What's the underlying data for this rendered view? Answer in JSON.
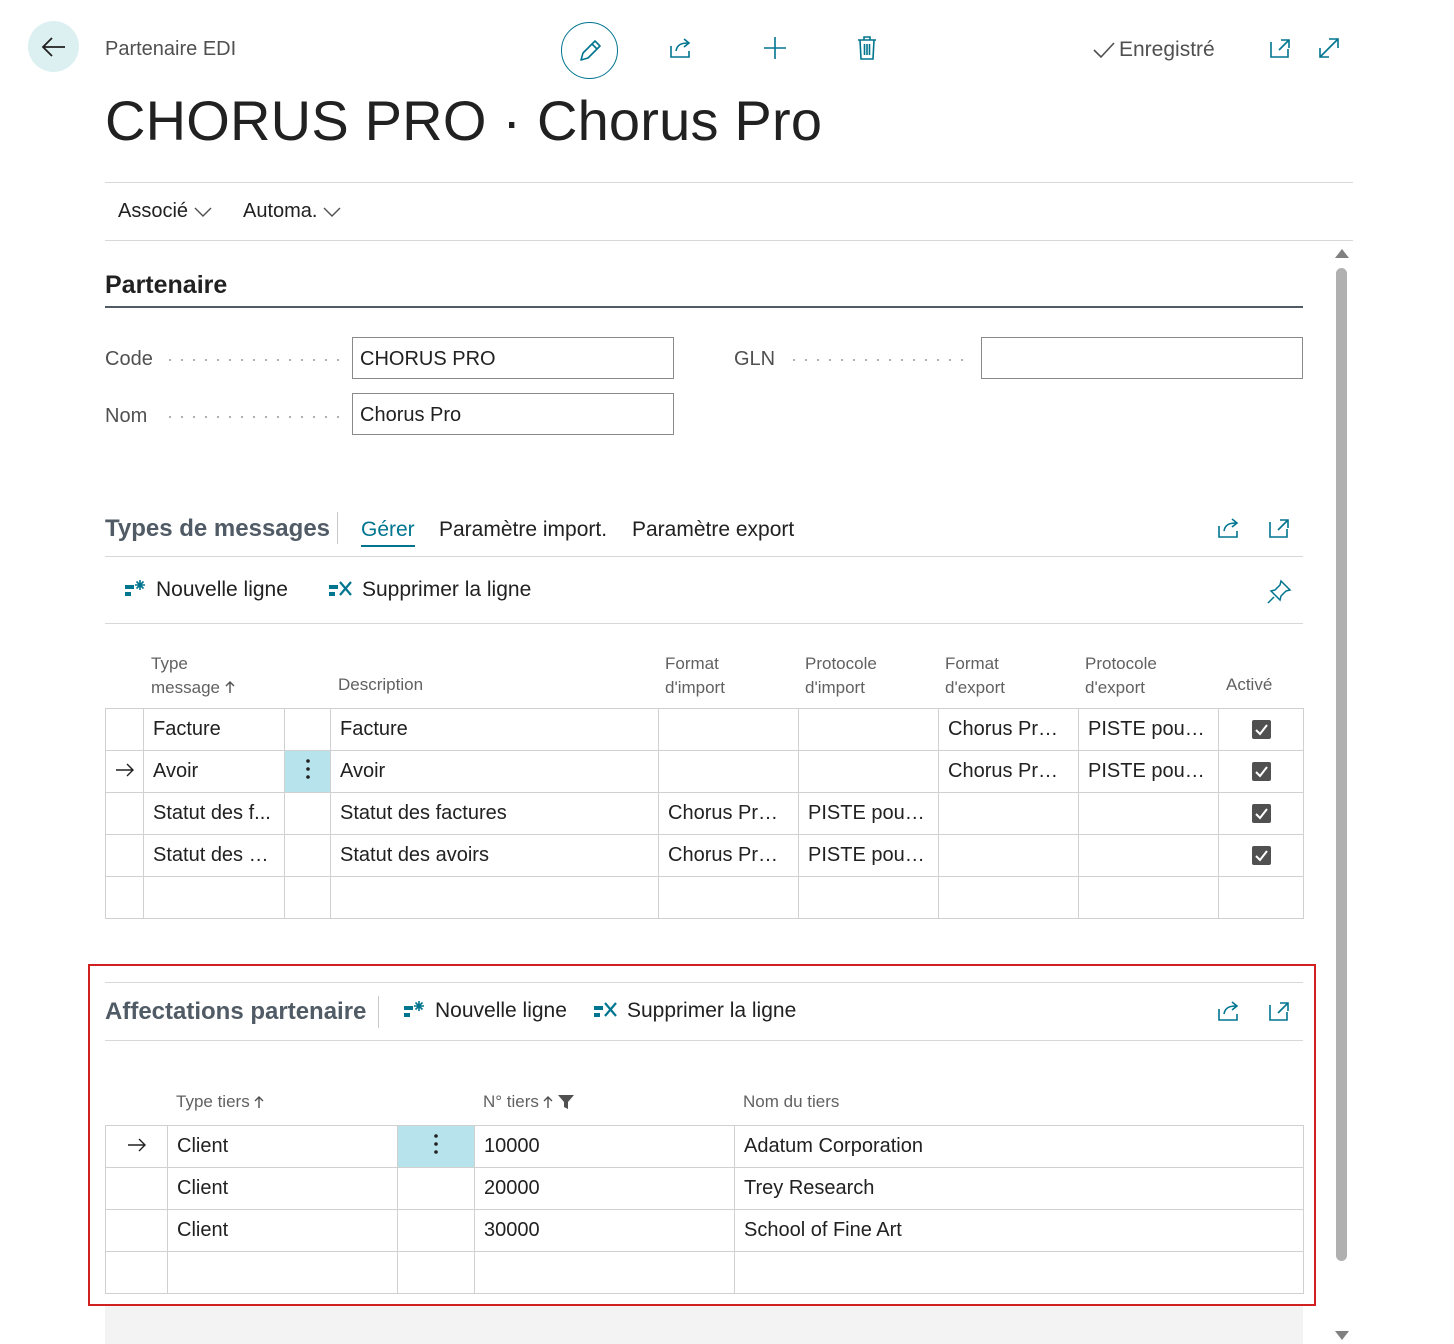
{
  "header": {
    "breadcrumb": "Partenaire EDI",
    "title": "CHORUS PRO · Chorus Pro",
    "saved_label": "Enregistré"
  },
  "action_menus": [
    {
      "label": "Associé"
    },
    {
      "label": "Automa."
    }
  ],
  "section": {
    "title": "Partenaire",
    "fields": {
      "code": {
        "label": "Code",
        "value": "CHORUS PRO"
      },
      "nom": {
        "label": "Nom",
        "value": "Chorus Pro"
      },
      "gln": {
        "label": "GLN",
        "value": ""
      }
    }
  },
  "message_types": {
    "title": "Types de messages",
    "tabs": [
      "Gérer",
      "Paramètre import.",
      "Paramètre export"
    ],
    "actions": {
      "new_line": "Nouvelle ligne",
      "delete_line": "Supprimer la ligne"
    },
    "columns": {
      "type": "Type message",
      "description": "Description",
      "format_import": "Format d'import",
      "protocol_import": "Protocole d'import",
      "format_export": "Format d'export",
      "protocol_export": "Protocole d'export",
      "active": "Activé"
    },
    "rows": [
      {
        "type": "Facture",
        "description": "Facture",
        "format_import": "",
        "protocol_import": "",
        "format_export": "Chorus Pro ...",
        "protocol_export": "PISTE pour ...",
        "active": true,
        "current": false
      },
      {
        "type": "Avoir",
        "description": "Avoir",
        "format_import": "",
        "protocol_import": "",
        "format_export": "Chorus Pro ...",
        "protocol_export": "PISTE pour ...",
        "active": true,
        "current": true
      },
      {
        "type": "Statut des f...",
        "description": "Statut des factures",
        "format_import": "Chorus Pro ...",
        "protocol_import": "PISTE pour ...",
        "format_export": "",
        "protocol_export": "",
        "active": true,
        "current": false
      },
      {
        "type": "Statut des a...",
        "description": "Statut des avoirs",
        "format_import": "Chorus Pro ...",
        "protocol_import": "PISTE pour ...",
        "format_export": "",
        "protocol_export": "",
        "active": true,
        "current": false
      }
    ]
  },
  "assignments": {
    "title": "Affectations partenaire",
    "actions": {
      "new_line": "Nouvelle ligne",
      "delete_line": "Supprimer la ligne"
    },
    "columns": {
      "type": "Type tiers",
      "number": "N° tiers",
      "name": "Nom du tiers"
    },
    "rows": [
      {
        "type": "Client",
        "number": "10000",
        "name": "Adatum Corporation",
        "current": true
      },
      {
        "type": "Client",
        "number": "20000",
        "name": "Trey Research",
        "current": false
      },
      {
        "type": "Client",
        "number": "30000",
        "name": "School of Fine Art",
        "current": false
      }
    ]
  },
  "colors": {
    "accent": "#00758f",
    "selection": "#b7e4ec",
    "highlight_frame": "#d02020"
  }
}
